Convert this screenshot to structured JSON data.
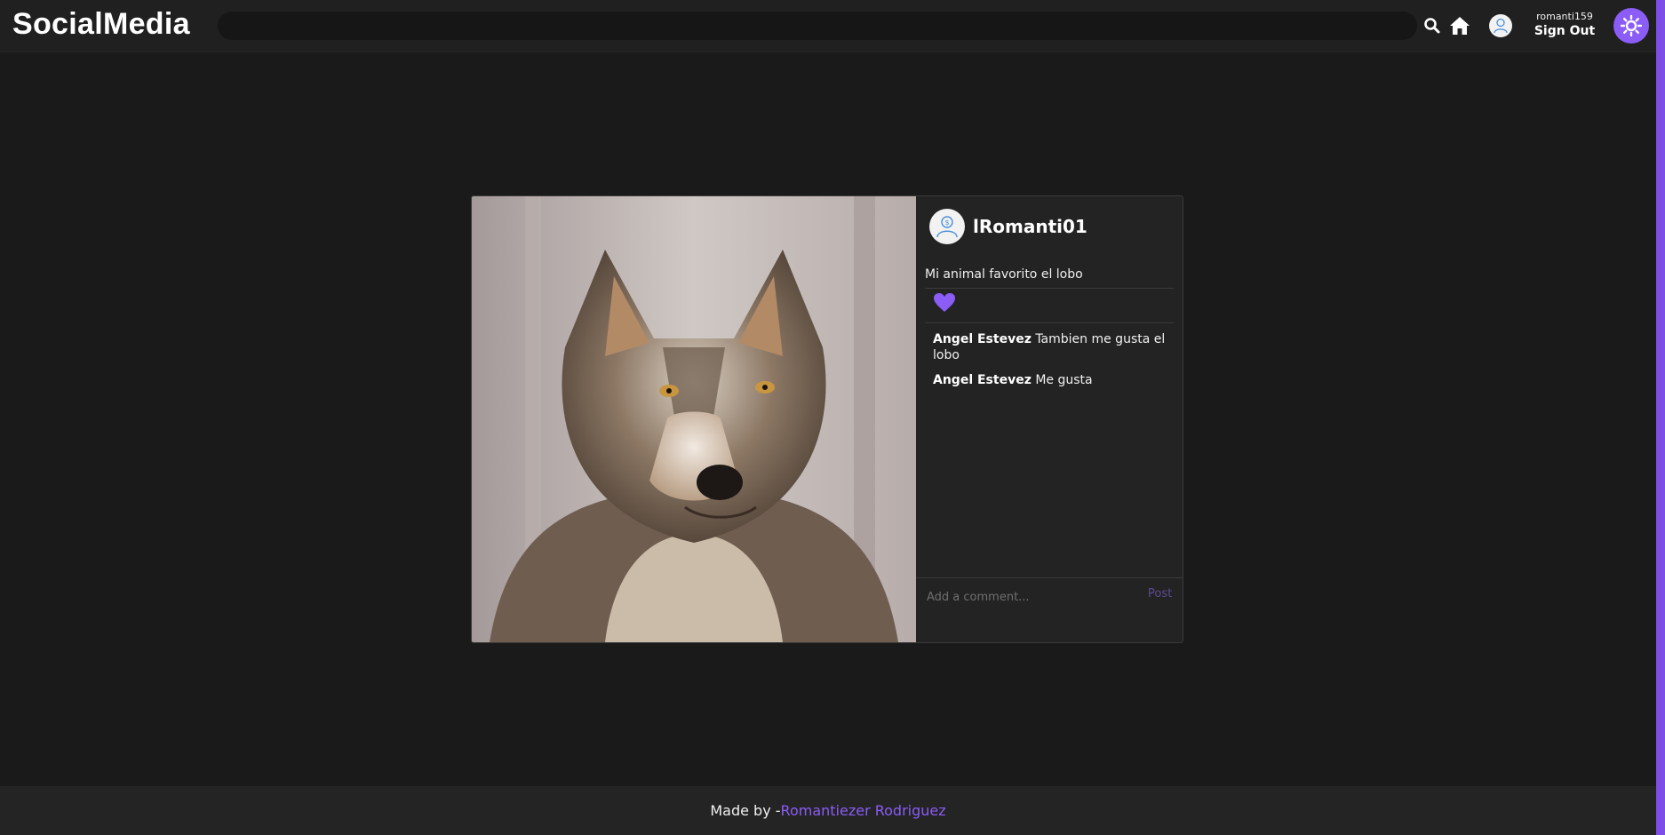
{
  "header": {
    "logo": "SocialMedia",
    "search": {
      "value": "",
      "placeholder": ""
    },
    "username": "romanti159",
    "signout_label": "Sign Out"
  },
  "post": {
    "author": "lRomanti01",
    "caption": "Mi animal favorito el lobo",
    "liked": true,
    "comments": [
      {
        "author": "Angel Estevez",
        "text": "Tambien me gusta el lobo"
      },
      {
        "author": "Angel Estevez",
        "text": "Me gusta"
      }
    ],
    "comment_input": {
      "value": "",
      "placeholder": "Add a comment..."
    },
    "post_label": "Post"
  },
  "footer": {
    "prefix": "Made by -",
    "author_link": "Romantiezer Rodriguez"
  },
  "colors": {
    "accent": "#8b5cf6",
    "background": "#1a1a1a",
    "header": "#202020",
    "card": "#232323"
  },
  "icons": [
    "search-icon",
    "home-icon",
    "user-avatar-icon",
    "sun-icon",
    "heart-icon"
  ]
}
